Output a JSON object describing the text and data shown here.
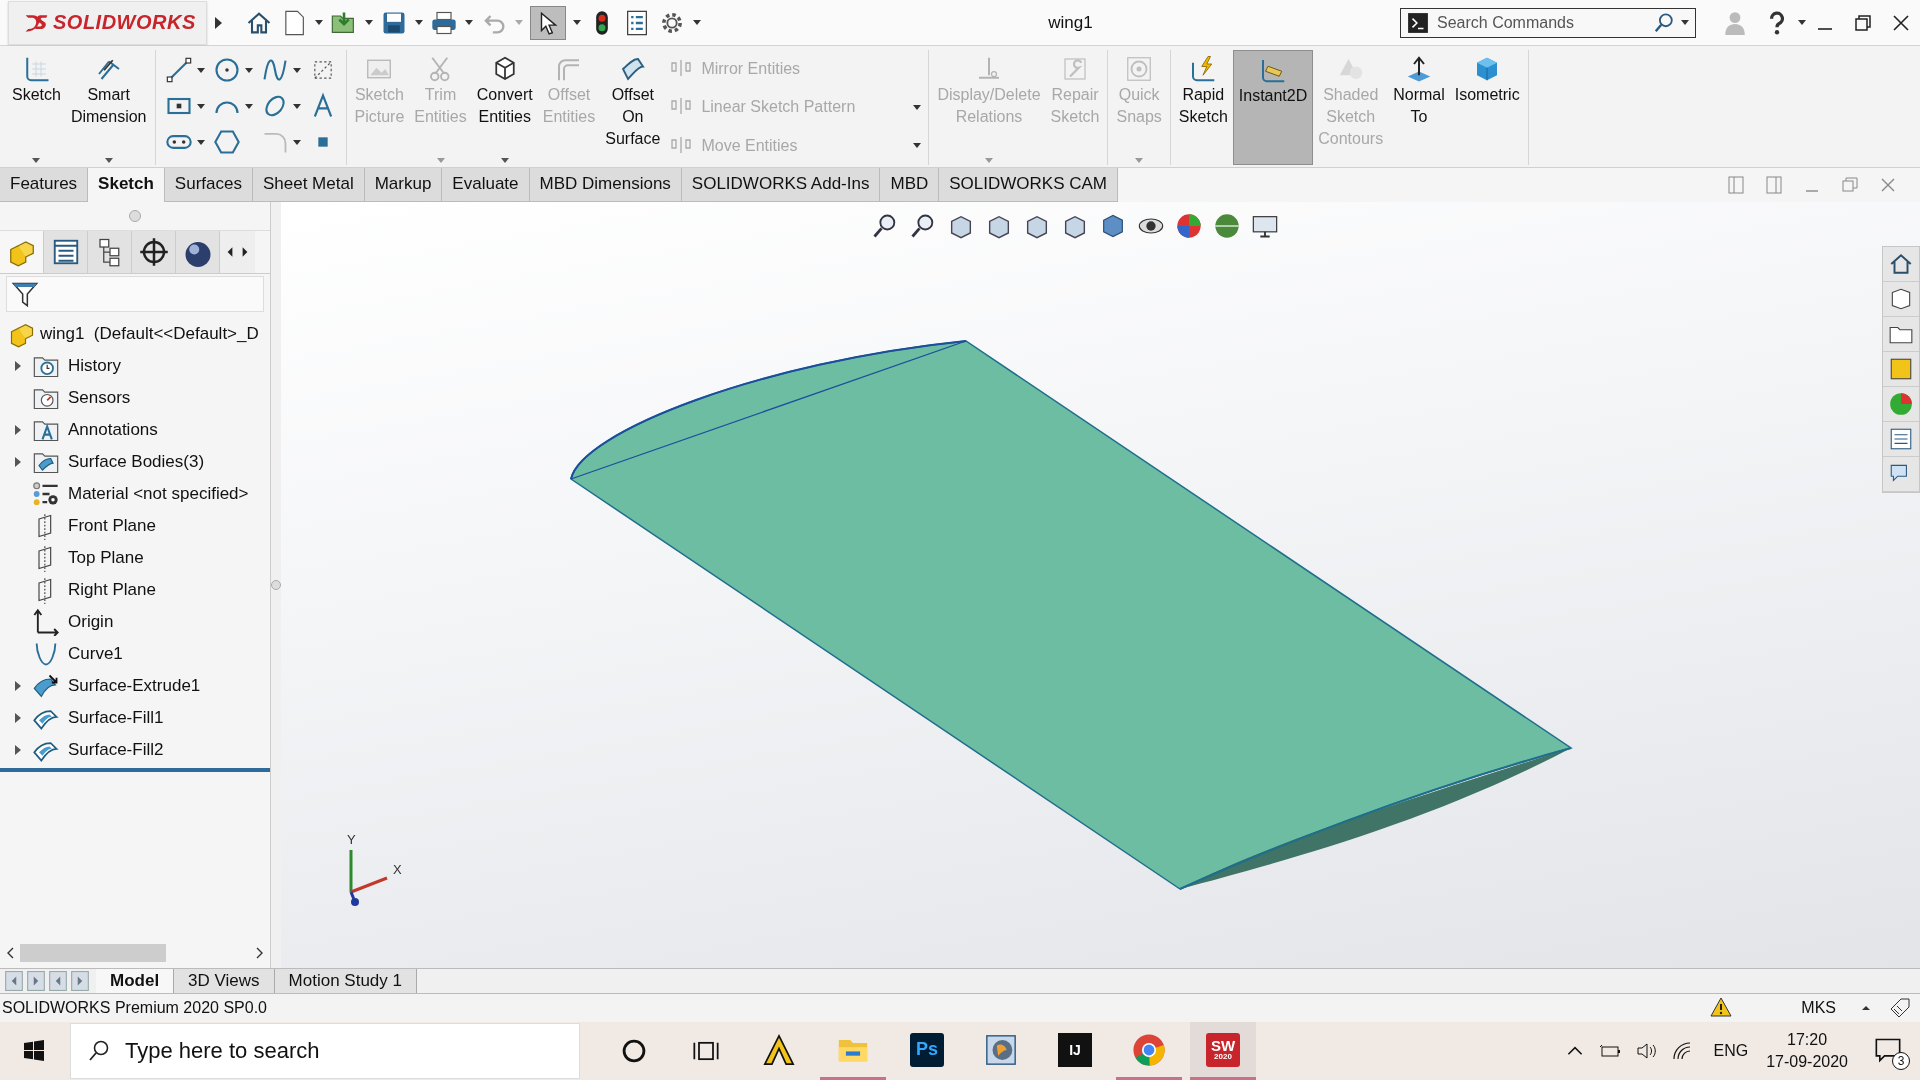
{
  "titlebar": {
    "logo": "SOLIDWORKS",
    "title": "wing1",
    "search_placeholder": "Search Commands"
  },
  "ribbon": {
    "groups": [
      [
        {
          "kind": "big",
          "label": "Sketch",
          "dropdown": true,
          "disabled": false,
          "pressed": false
        },
        {
          "kind": "big",
          "label": "Smart Dimension",
          "dropdown": true,
          "disabled": false,
          "pressed": false
        }
      ],
      [
        {
          "kind": "tools"
        }
      ],
      [
        {
          "kind": "big",
          "label": "Sketch Picture",
          "dropdown": false,
          "disabled": true,
          "pressed": false
        },
        {
          "kind": "big",
          "label": "Trim Entities",
          "dropdown": true,
          "disabled": true,
          "pressed": false
        },
        {
          "kind": "big",
          "label": "Convert Entities",
          "dropdown": true,
          "disabled": false,
          "pressed": false
        },
        {
          "kind": "big",
          "label": "Offset Entities",
          "dropdown": false,
          "disabled": true,
          "pressed": false
        },
        {
          "kind": "big",
          "label": "Offset On Surface",
          "dropdown": false,
          "disabled": false,
          "pressed": false
        },
        {
          "kind": "list",
          "entries": [
            {
              "label": "Mirror Entities",
              "disabled": true,
              "dropdown": false
            },
            {
              "label": "Linear Sketch Pattern",
              "disabled": true,
              "dropdown": true
            },
            {
              "label": "Move Entities",
              "disabled": true,
              "dropdown": true
            }
          ]
        }
      ],
      [
        {
          "kind": "big",
          "label": "Display/Delete Relations",
          "dropdown": true,
          "disabled": true,
          "pressed": false
        },
        {
          "kind": "big",
          "label": "Repair Sketch",
          "dropdown": false,
          "disabled": true,
          "pressed": false
        }
      ],
      [
        {
          "kind": "big",
          "label": "Quick Snaps",
          "dropdown": true,
          "disabled": true,
          "pressed": false
        }
      ],
      [
        {
          "kind": "big",
          "label": "Rapid Sketch",
          "dropdown": false,
          "disabled": false,
          "pressed": false
        },
        {
          "kind": "big",
          "label": "Instant2D",
          "dropdown": false,
          "disabled": false,
          "pressed": true
        },
        {
          "kind": "big",
          "label": "Shaded Sketch Contours",
          "dropdown": false,
          "disabled": true,
          "pressed": false
        },
        {
          "kind": "big",
          "label": "Normal To",
          "dropdown": false,
          "disabled": false,
          "pressed": false
        },
        {
          "kind": "big",
          "label": "Isometric",
          "dropdown": false,
          "disabled": false,
          "pressed": false
        }
      ]
    ]
  },
  "command_tabs": [
    {
      "label": "Features",
      "selected": false
    },
    {
      "label": "Sketch",
      "selected": true
    },
    {
      "label": "Surfaces",
      "selected": false
    },
    {
      "label": "Sheet Metal",
      "selected": false
    },
    {
      "label": "Markup",
      "selected": false
    },
    {
      "label": "Evaluate",
      "selected": false
    },
    {
      "label": "MBD Dimensions",
      "selected": false
    },
    {
      "label": "SOLIDWORKS Add-Ins",
      "selected": false
    },
    {
      "label": "MBD",
      "selected": false
    },
    {
      "label": "SOLIDWORKS CAM",
      "selected": false
    }
  ],
  "feature_tree": {
    "root": "wing1  (Default<<Default>_D",
    "items": [
      {
        "label": "History",
        "kind": "history",
        "expandable": true
      },
      {
        "label": "Sensors",
        "kind": "sensors",
        "expandable": false
      },
      {
        "label": "Annotations",
        "kind": "annotations",
        "expandable": true
      },
      {
        "label": "Surface Bodies(3)",
        "kind": "bodies",
        "expandable": true
      },
      {
        "label": "Material <not specified>",
        "kind": "material",
        "expandable": false
      },
      {
        "label": "Front Plane",
        "kind": "plane",
        "expandable": false
      },
      {
        "label": "Top Plane",
        "kind": "plane",
        "expandable": false
      },
      {
        "label": "Right Plane",
        "kind": "plane",
        "expandable": false
      },
      {
        "label": "Origin",
        "kind": "origin",
        "expandable": false
      },
      {
        "label": "Curve1",
        "kind": "curve",
        "expandable": false
      },
      {
        "label": "Surface-Extrude1",
        "kind": "extrude",
        "expandable": true
      },
      {
        "label": "Surface-Fill1",
        "kind": "fill",
        "expandable": true
      },
      {
        "label": "Surface-Fill2",
        "kind": "fill",
        "expandable": true
      }
    ]
  },
  "triad": {
    "y_label": "Y",
    "x_label": "X"
  },
  "bottom_tabs": [
    {
      "label": "Model",
      "selected": true
    },
    {
      "label": "3D Views",
      "selected": false
    },
    {
      "label": "Motion Study 1",
      "selected": false
    }
  ],
  "status_bar": {
    "product": "SOLIDWORKS Premium 2020 SP0.0",
    "units": "MKS"
  },
  "taskbar": {
    "search_placeholder": "Type here to search",
    "apps": [
      {
        "kind": "arch",
        "running": false,
        "active": false
      },
      {
        "kind": "folder",
        "running": true,
        "active": false
      },
      {
        "kind": "ps",
        "label": "Ps",
        "running": false,
        "active": false
      },
      {
        "kind": "render",
        "running": false,
        "active": false
      },
      {
        "kind": "ij",
        "label": "IJ",
        "running": false,
        "active": false
      },
      {
        "kind": "browser",
        "running": true,
        "active": false
      },
      {
        "kind": "sw",
        "label": "SW",
        "sublabel": "2020",
        "running": true,
        "active": true
      }
    ],
    "language": "ENG",
    "time": "17:20",
    "date": "17-09-2020",
    "notifications": "3"
  }
}
